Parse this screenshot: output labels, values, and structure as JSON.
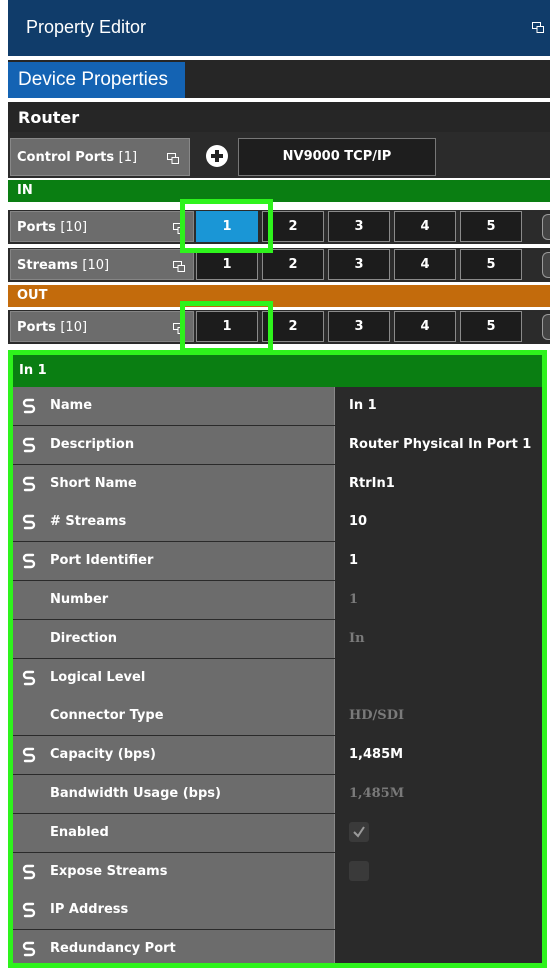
{
  "header": {
    "title": "Property Editor",
    "detach_icon": "detach-window-icon"
  },
  "tabs": [
    {
      "label": "Device Properties",
      "active": true
    }
  ],
  "router": {
    "label": "Router",
    "control_ports": {
      "label": "Control Ports",
      "count": "[1]",
      "protocol": "NV9000 TCP/IP"
    }
  },
  "in_section": {
    "label": "IN",
    "ports": {
      "label": "Ports",
      "count": "[10]",
      "buttons": [
        "1",
        "2",
        "3",
        "4",
        "5"
      ],
      "selected": "1"
    },
    "streams": {
      "label": "Streams",
      "count": "[10]",
      "buttons": [
        "1",
        "2",
        "3",
        "4",
        "5"
      ]
    }
  },
  "out_section": {
    "label": "OUT",
    "ports": {
      "label": "Ports",
      "count": "[10]",
      "buttons": [
        "1",
        "2",
        "3",
        "4",
        "5"
      ]
    }
  },
  "details": {
    "title": "In 1",
    "rows": [
      {
        "name": "Name",
        "value": "In 1",
        "linked": true,
        "dim": false
      },
      {
        "name": "Description",
        "value": "Router Physical In Port 1",
        "linked": true,
        "dim": false
      },
      {
        "name": "Short Name",
        "value": "RtrIn1",
        "linked": true,
        "dim": false
      },
      {
        "name": "# Streams",
        "value": "10",
        "linked": true,
        "dim": false
      },
      {
        "name": "Port Identifier",
        "value": "1",
        "linked": true,
        "dim": false
      },
      {
        "name": "Number",
        "value": "1",
        "linked": false,
        "dim": true
      },
      {
        "name": "Direction",
        "value": "In",
        "linked": false,
        "dim": true
      },
      {
        "name": "Logical Level",
        "value": "",
        "linked": true,
        "dim": false
      },
      {
        "name": "Connector Type",
        "value": "HD/SDI",
        "linked": false,
        "dim": true
      },
      {
        "name": "Capacity (bps)",
        "value": "1,485M",
        "linked": true,
        "dim": false
      },
      {
        "name": "Bandwidth Usage (bps)",
        "value": "1,485M",
        "linked": false,
        "dim": true
      },
      {
        "name": "Enabled",
        "value": "",
        "checkbox": true,
        "checked": true,
        "linked": false,
        "dim": true
      },
      {
        "name": "Expose Streams",
        "value": "",
        "checkbox": true,
        "checked": false,
        "linked": true,
        "dim": false
      },
      {
        "name": "IP Address",
        "value": "",
        "linked": true,
        "dim": false
      },
      {
        "name": "Redundancy Port",
        "value": "",
        "linked": true,
        "dim": false
      }
    ]
  },
  "colors": {
    "title_bar": "#103c6a",
    "tab_active": "#1463b3",
    "in_header": "#0a7e12",
    "out_header": "#c36b0c",
    "selected_port": "#1a96d6",
    "highlight": "#2ef31c"
  }
}
